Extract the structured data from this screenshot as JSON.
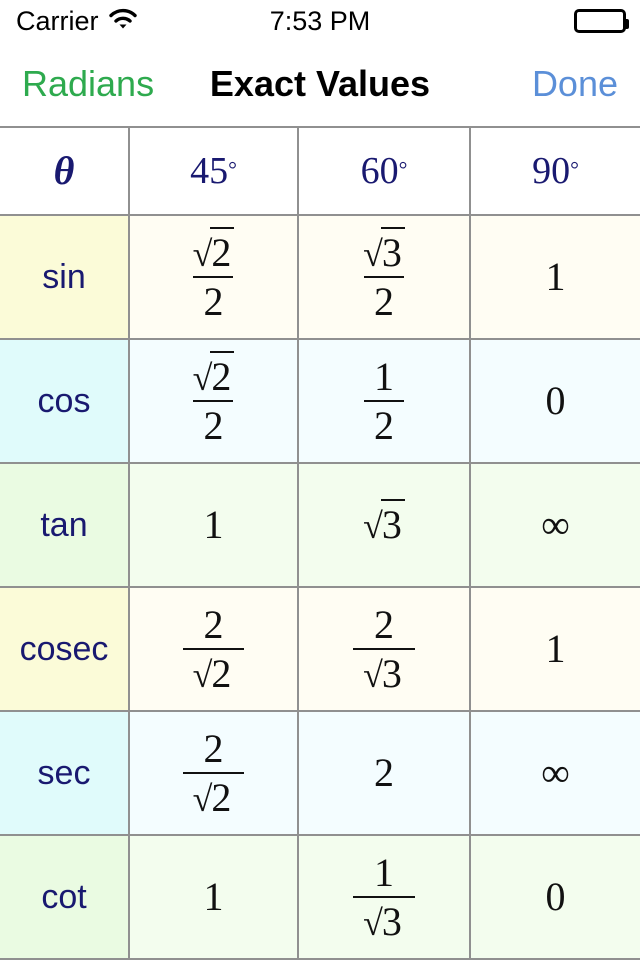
{
  "status_bar": {
    "carrier": "Carrier",
    "wifi_icon": "wifi-icon",
    "time": "7:53 PM",
    "battery_icon": "battery-full-icon"
  },
  "nav_bar": {
    "left_button": "Radians",
    "title": "Exact Values",
    "right_button": "Done",
    "left_color": "#2eaa4e",
    "right_color": "#5b8fd8",
    "title_color": "#000000"
  },
  "table": {
    "columns": [
      {
        "label": "θ",
        "is_theta": true,
        "degree": ""
      },
      {
        "label": "45",
        "is_theta": false,
        "degree": "°"
      },
      {
        "label": "60",
        "is_theta": false,
        "degree": "°"
      },
      {
        "label": "90",
        "is_theta": false,
        "degree": "°"
      }
    ],
    "rows": [
      {
        "label": "sin",
        "tint": "yellow",
        "cells": [
          {
            "type": "fraction",
            "numerator": "√2",
            "denominator": "2",
            "text": "√2/2"
          },
          {
            "type": "fraction",
            "numerator": "√3",
            "denominator": "2",
            "text": "√3/2"
          },
          {
            "type": "plain",
            "text": "1"
          }
        ]
      },
      {
        "label": "cos",
        "tint": "cyan",
        "cells": [
          {
            "type": "fraction",
            "numerator": "√2",
            "denominator": "2",
            "text": "√2/2"
          },
          {
            "type": "fraction",
            "numerator": "1",
            "denominator": "2",
            "text": "1/2"
          },
          {
            "type": "plain",
            "text": "0"
          }
        ]
      },
      {
        "label": "tan",
        "tint": "green",
        "cells": [
          {
            "type": "plain",
            "text": "1"
          },
          {
            "type": "radical",
            "text": "√3"
          },
          {
            "type": "plain",
            "text": "∞"
          }
        ]
      },
      {
        "label": "cosec",
        "tint": "yellow",
        "cells": [
          {
            "type": "fraction",
            "numerator": "2",
            "denominator": "√2",
            "text": "2/√2"
          },
          {
            "type": "fraction",
            "numerator": "2",
            "denominator": "√3",
            "text": "2/√3"
          },
          {
            "type": "plain",
            "text": "1"
          }
        ]
      },
      {
        "label": "sec",
        "tint": "cyan",
        "cells": [
          {
            "type": "fraction",
            "numerator": "2",
            "denominator": "√2",
            "text": "2/√2"
          },
          {
            "type": "plain",
            "text": "2"
          },
          {
            "type": "plain",
            "text": "∞"
          }
        ]
      },
      {
        "label": "cot",
        "tint": "green",
        "cells": [
          {
            "type": "plain",
            "text": "1"
          },
          {
            "type": "fraction",
            "numerator": "1",
            "denominator": "√3",
            "text": "1/√3"
          },
          {
            "type": "plain",
            "text": "0"
          }
        ]
      }
    ]
  }
}
